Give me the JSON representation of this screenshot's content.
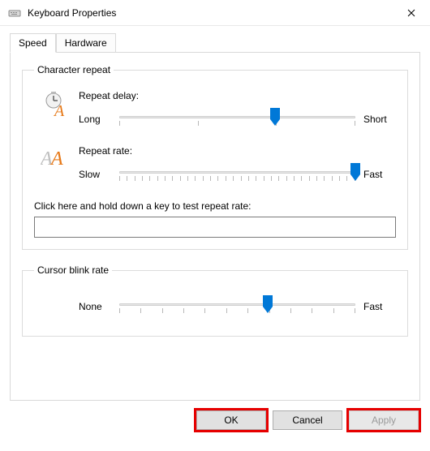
{
  "window": {
    "title": "Keyboard Properties"
  },
  "tabs": {
    "speed": "Speed",
    "hardware": "Hardware"
  },
  "groups": {
    "char_repeat": "Character repeat",
    "blink": "Cursor blink rate"
  },
  "repeat_delay": {
    "label": "Repeat delay:",
    "left": "Long",
    "right": "Short",
    "thumb_percent": 66
  },
  "repeat_rate": {
    "label": "Repeat rate:",
    "left": "Slow",
    "right": "Fast",
    "thumb_percent": 100
  },
  "test": {
    "label": "Click here and hold down a key to test repeat rate:",
    "value": ""
  },
  "blink": {
    "left": "None",
    "right": "Fast",
    "thumb_percent": 63
  },
  "buttons": {
    "ok": "OK",
    "cancel": "Cancel",
    "apply": "Apply"
  }
}
